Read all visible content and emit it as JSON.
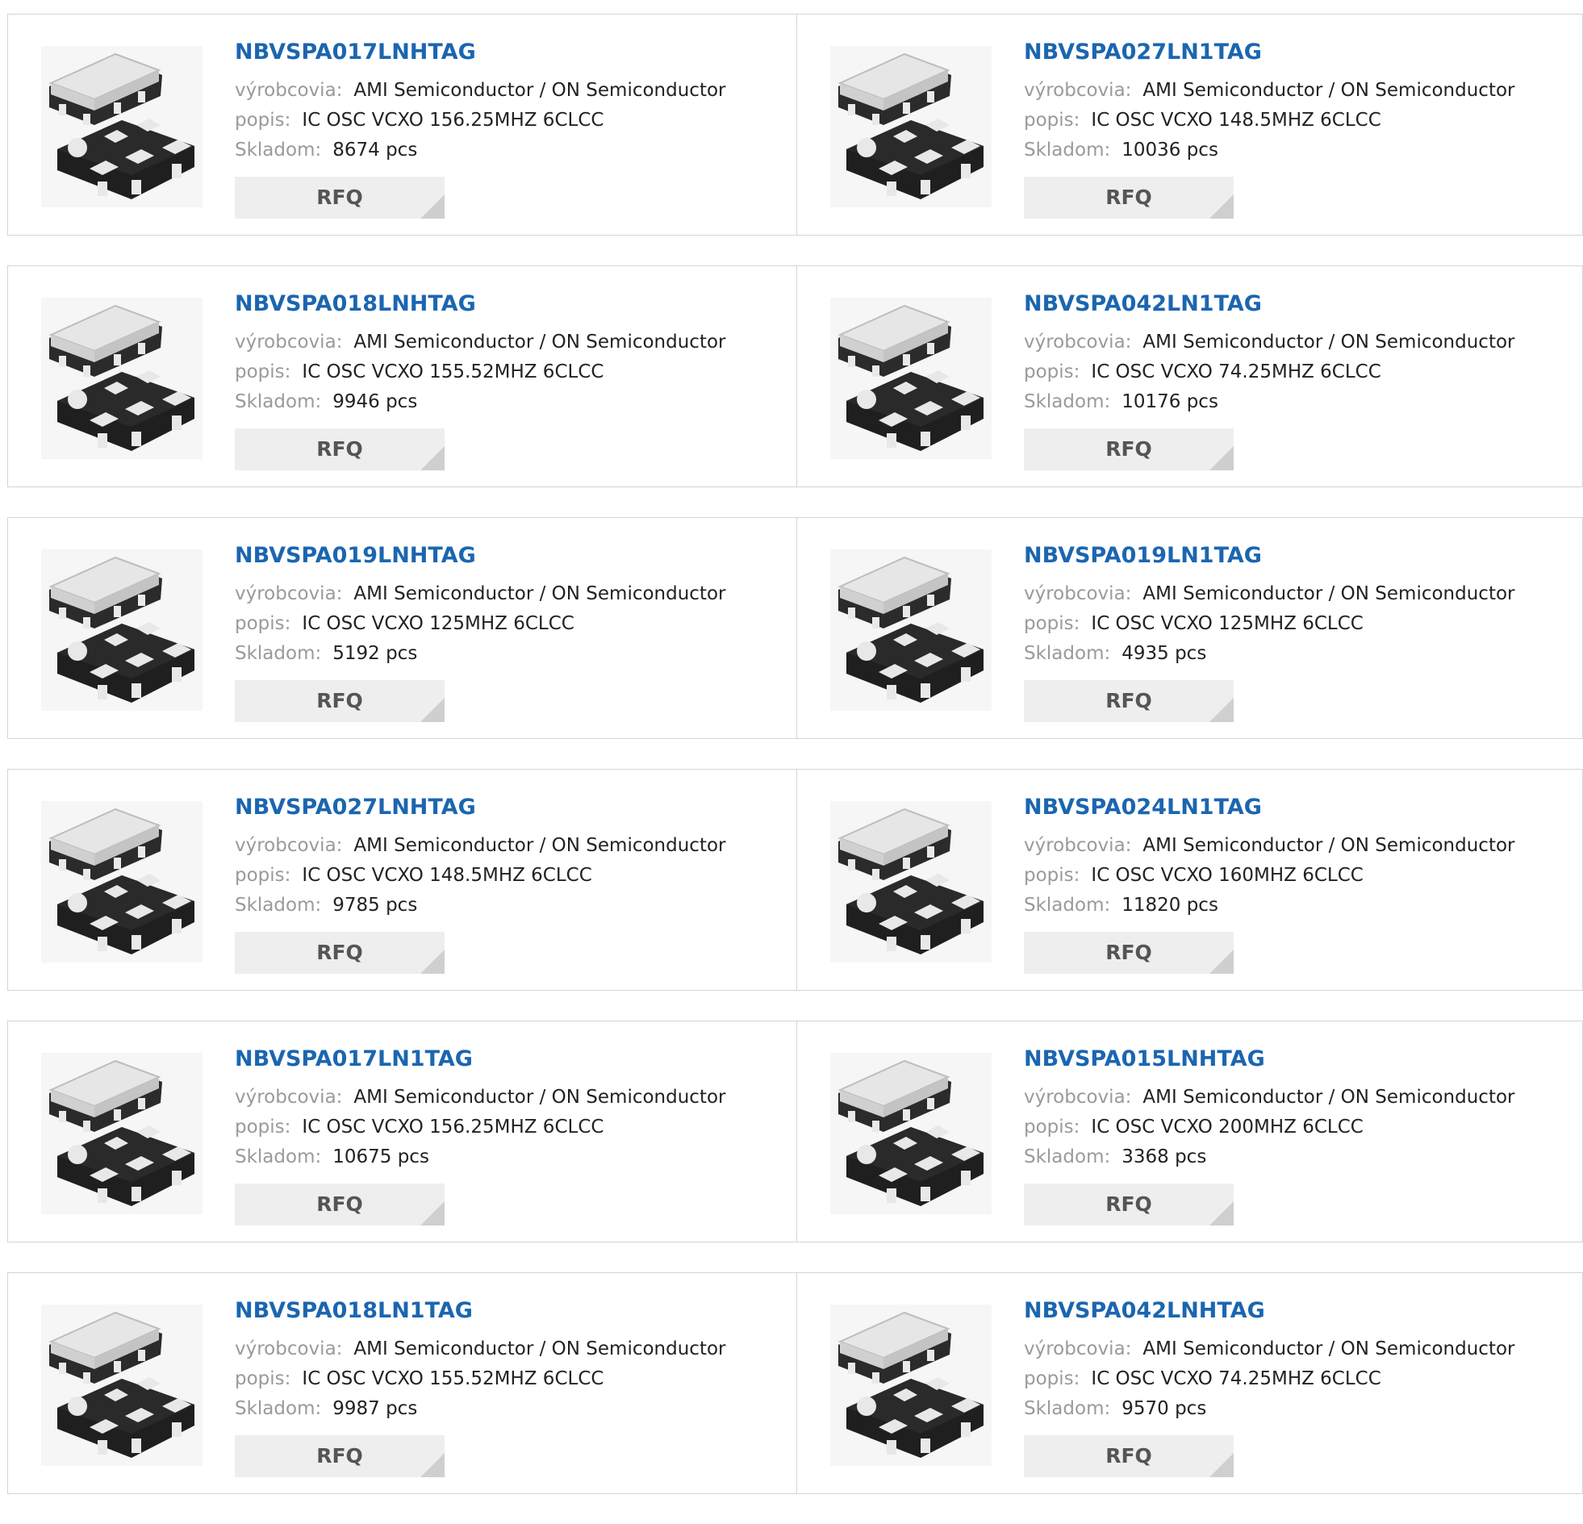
{
  "labels": {
    "manufacturer": "výrobcovia:",
    "description": "popis:",
    "stock": "Skladom:",
    "rfq_button": "RFQ"
  },
  "thumbnail_icon": "oscillator-package-icon",
  "colors": {
    "part_number_link": "#1b66b0",
    "label_gray": "#9a9a9a",
    "button_background": "#eeeeee",
    "border": "#d4d4d4"
  },
  "products": [
    {
      "part_number": "NBVSPA017LNHTAG",
      "manufacturer": "AMI Semiconductor / ON Semiconductor",
      "description": "IC OSC VCXO 156.25MHZ 6CLCC",
      "stock": "8674 pcs"
    },
    {
      "part_number": "NBVSPA027LN1TAG",
      "manufacturer": "AMI Semiconductor / ON Semiconductor",
      "description": "IC OSC VCXO 148.5MHZ 6CLCC",
      "stock": "10036 pcs"
    },
    {
      "part_number": "NBVSPA018LNHTAG",
      "manufacturer": "AMI Semiconductor / ON Semiconductor",
      "description": "IC OSC VCXO 155.52MHZ 6CLCC",
      "stock": "9946 pcs"
    },
    {
      "part_number": "NBVSPA042LN1TAG",
      "manufacturer": "AMI Semiconductor / ON Semiconductor",
      "description": "IC OSC VCXO 74.25MHZ 6CLCC",
      "stock": "10176 pcs"
    },
    {
      "part_number": "NBVSPA019LNHTAG",
      "manufacturer": "AMI Semiconductor / ON Semiconductor",
      "description": "IC OSC VCXO 125MHZ 6CLCC",
      "stock": "5192 pcs"
    },
    {
      "part_number": "NBVSPA019LN1TAG",
      "manufacturer": "AMI Semiconductor / ON Semiconductor",
      "description": "IC OSC VCXO 125MHZ 6CLCC",
      "stock": "4935 pcs"
    },
    {
      "part_number": "NBVSPA027LNHTAG",
      "manufacturer": "AMI Semiconductor / ON Semiconductor",
      "description": "IC OSC VCXO 148.5MHZ 6CLCC",
      "stock": "9785 pcs"
    },
    {
      "part_number": "NBVSPA024LN1TAG",
      "manufacturer": "AMI Semiconductor / ON Semiconductor",
      "description": "IC OSC VCXO 160MHZ 6CLCC",
      "stock": "11820 pcs"
    },
    {
      "part_number": "NBVSPA017LN1TAG",
      "manufacturer": "AMI Semiconductor / ON Semiconductor",
      "description": "IC OSC VCXO 156.25MHZ 6CLCC",
      "stock": "10675 pcs"
    },
    {
      "part_number": "NBVSPA015LNHTAG",
      "manufacturer": "AMI Semiconductor / ON Semiconductor",
      "description": "IC OSC VCXO 200MHZ 6CLCC",
      "stock": "3368 pcs"
    },
    {
      "part_number": "NBVSPA018LN1TAG",
      "manufacturer": "AMI Semiconductor / ON Semiconductor",
      "description": "IC OSC VCXO 155.52MHZ 6CLCC",
      "stock": "9987 pcs"
    },
    {
      "part_number": "NBVSPA042LNHTAG",
      "manufacturer": "AMI Semiconductor / ON Semiconductor",
      "description": "IC OSC VCXO 74.25MHZ 6CLCC",
      "stock": "9570 pcs"
    }
  ]
}
